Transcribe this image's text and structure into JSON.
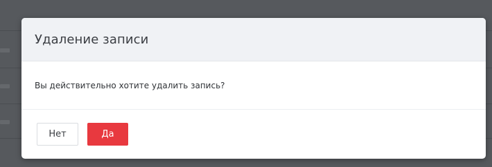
{
  "dialog": {
    "title": "Удаление записи",
    "message": "Вы действительно хотите удалить запись?",
    "buttons": {
      "no_label": "Нет",
      "yes_label": "Да"
    }
  },
  "colors": {
    "overlay": "#56595d",
    "header_bg": "#f0f2f5",
    "danger": "#e8393f"
  }
}
